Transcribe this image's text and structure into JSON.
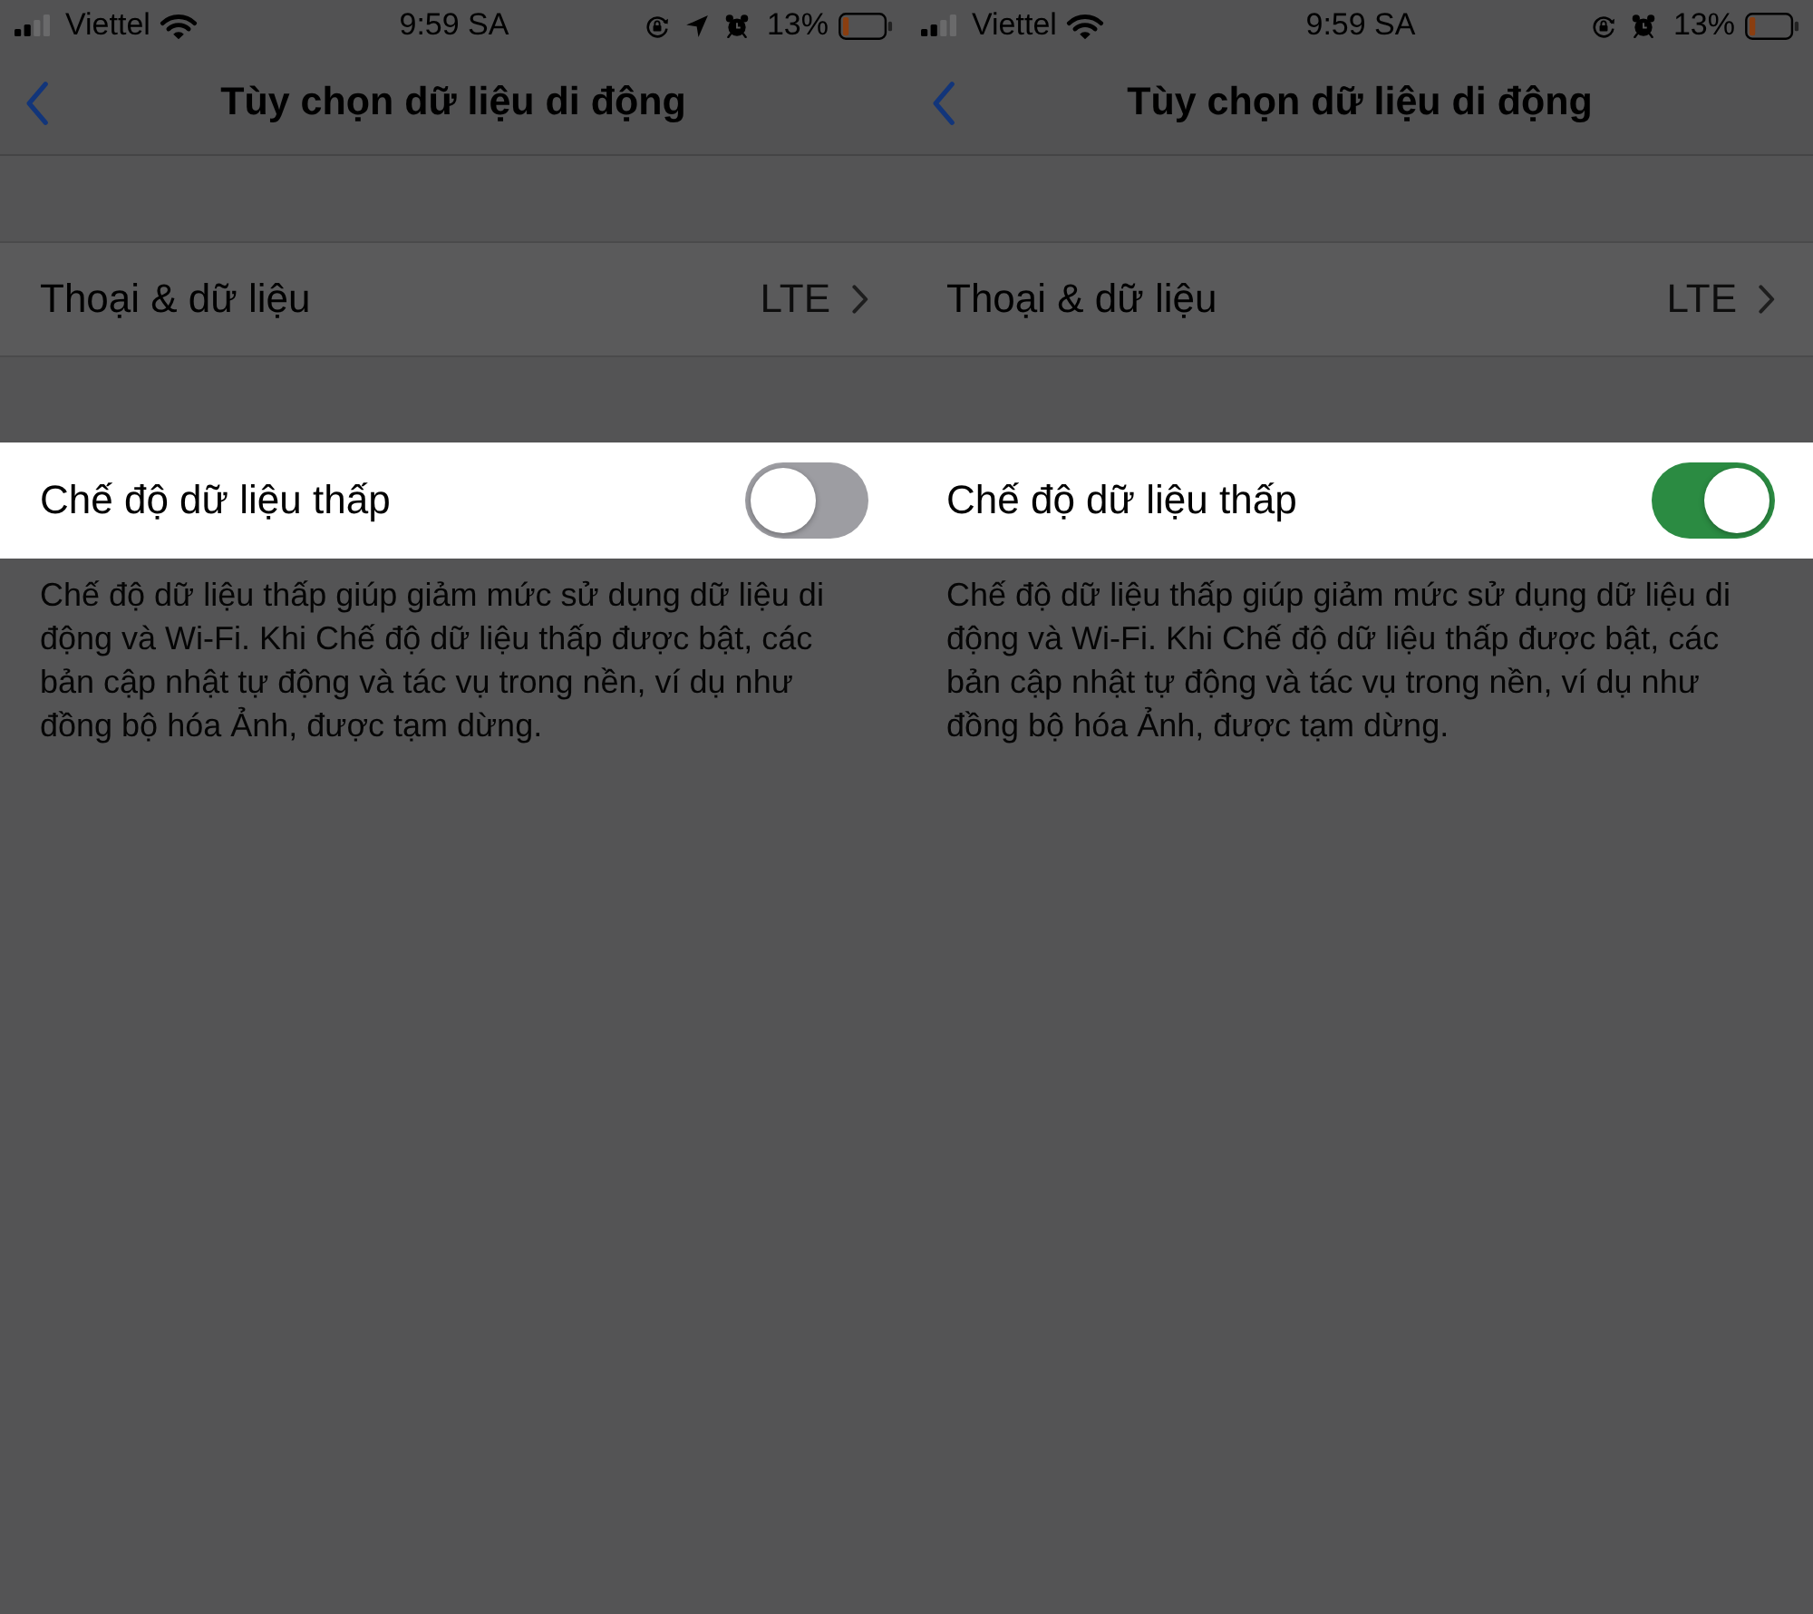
{
  "phones": [
    {
      "status_bar": {
        "carrier": "Viettel",
        "time": "9:59 SA",
        "indicators": [
          {
            "kind": "rotation-lock"
          },
          {
            "kind": "location"
          },
          {
            "kind": "alarm"
          }
        ],
        "battery": "13%"
      },
      "nav": {
        "title": "Tùy chọn dữ liệu di động"
      },
      "rows": [
        {
          "kind": "link",
          "label": "Thoại & dữ liệu",
          "value": "LTE",
          "highlighted": false
        },
        {
          "kind": "toggle",
          "label": "Chế độ dữ liệu thấp",
          "on": false,
          "highlighted": true
        }
      ],
      "footer": "Chế độ dữ liệu thấp giúp giảm mức sử dụng dữ liệu di động và Wi-Fi. Khi Chế độ dữ liệu thấp được bật, các bản cập nhật tự động và tác vụ trong nền, ví dụ như đồng bộ hóa Ảnh, được tạm dừng."
    },
    {
      "status_bar": {
        "carrier": "Viettel",
        "time": "9:59 SA",
        "indicators": [
          {
            "kind": "rotation-lock"
          },
          {
            "kind": "alarm"
          }
        ],
        "battery": "13%"
      },
      "nav": {
        "title": "Tùy chọn dữ liệu di động"
      },
      "rows": [
        {
          "kind": "link",
          "label": "Thoại & dữ liệu",
          "value": "LTE",
          "highlighted": false
        },
        {
          "kind": "toggle",
          "label": "Chế độ dữ liệu thấp",
          "on": true,
          "highlighted": true
        }
      ],
      "footer": "Chế độ dữ liệu thấp giúp giảm mức sử dụng dữ liệu di động và Wi-Fi. Khi Chế độ dữ liệu thấp được bật, các bản cập nhật tự động và tác vụ trong nền, ví dụ như đồng bộ hóa Ảnh, được tạm dừng."
    }
  ]
}
